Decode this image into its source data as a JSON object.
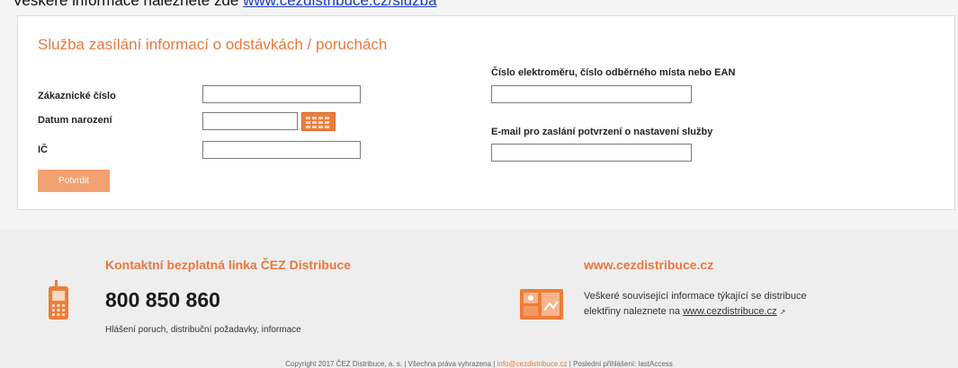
{
  "top_text": {
    "prefix": "Veškeré informace naleznete zde",
    "link": "www.cezdistribuce.cz/sluzba"
  },
  "form": {
    "title": "Služba zasílání informací o odstávkách / poruchách",
    "customer_number_label": "Zákaznické číslo",
    "birth_date_label": "Datum narození",
    "ic_label": "IČ",
    "meter_label": "Číslo elektroměru, číslo odběrného místa nebo EAN",
    "email_label": "E-mail pro zaslání potvrzení o nastavení služby",
    "submit_label": "Potvrdit",
    "customer_number_value": "",
    "birth_date_value": "",
    "ic_value": "",
    "meter_value": "",
    "email_value": ""
  },
  "footer": {
    "hotline_heading": "Kontaktní bezplatná linka ČEZ Distribuce",
    "phone": "800 850 860",
    "hotline_sub": "Hlášení poruch, distribuční požadavky, informace",
    "web_heading": "www.cezdistribuce.cz",
    "web_desc_line1": "Veškeré související informace týkající se distribuce",
    "web_desc_line2_prefix": "elektřiny naleznete na",
    "web_desc_link": "www.cezdistribuce.cz",
    "copyright_prefix": "Copyright 2017 ČEZ Distribuce, a. s. | Všechna práva vyhrazena |",
    "copyright_email": "info@cezdistribuce.cz",
    "copyright_suffix": "| Poslední přihlášení: lastAccess"
  },
  "colors": {
    "accent": "#e8783e",
    "button": "#f2a173",
    "calendar": "#ee7d3a",
    "link": "#1a3cc4"
  },
  "icons": {
    "calendar": "calendar-icon",
    "phone": "phone-icon",
    "web": "globe-icon"
  }
}
